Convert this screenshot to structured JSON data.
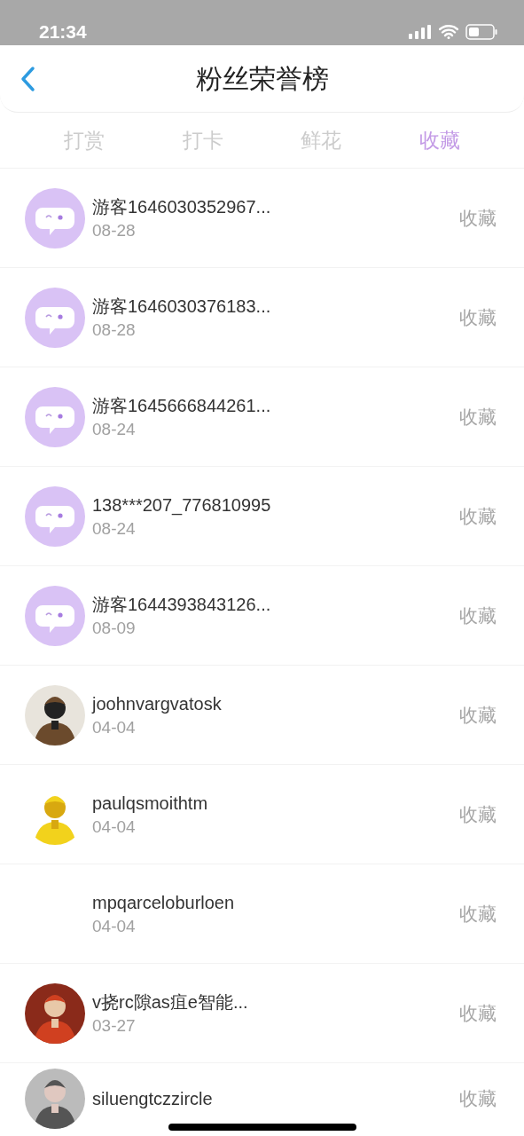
{
  "status_bar": {
    "time": "21:34"
  },
  "header": {
    "title": "粉丝荣誉榜"
  },
  "tabs": [
    {
      "label": "打赏",
      "selected": false
    },
    {
      "label": "打卡",
      "selected": false
    },
    {
      "label": "鲜花",
      "selected": false
    },
    {
      "label": "收藏",
      "selected": true
    }
  ],
  "rows": [
    {
      "avatar": {
        "kind": "default"
      },
      "name": "游客1646030352967...",
      "date": "08-28",
      "action": "收藏"
    },
    {
      "avatar": {
        "kind": "default"
      },
      "name": "游客1646030376183...",
      "date": "08-28",
      "action": "收藏"
    },
    {
      "avatar": {
        "kind": "default"
      },
      "name": "游客1645666844261...",
      "date": "08-24",
      "action": "收藏"
    },
    {
      "avatar": {
        "kind": "default"
      },
      "name": "138***207_776810995",
      "date": "08-24",
      "action": "收藏"
    },
    {
      "avatar": {
        "kind": "default"
      },
      "name": "游客1644393843126...",
      "date": "08-09",
      "action": "收藏"
    },
    {
      "name": "joohnvargvatosk",
      "date": "04-04",
      "action": "收藏"
    },
    {
      "name": "paulqsmoithtm",
      "date": "04-04",
      "action": "收藏"
    },
    {
      "name": "mpqarceloburloen",
      "date": "04-04",
      "action": "收藏"
    },
    {
      "name": "v挠rc隙as疽e智能...",
      "date": "03-27",
      "action": "收藏"
    },
    {
      "name": "siluengtczzircle",
      "action": "收藏"
    }
  ]
}
